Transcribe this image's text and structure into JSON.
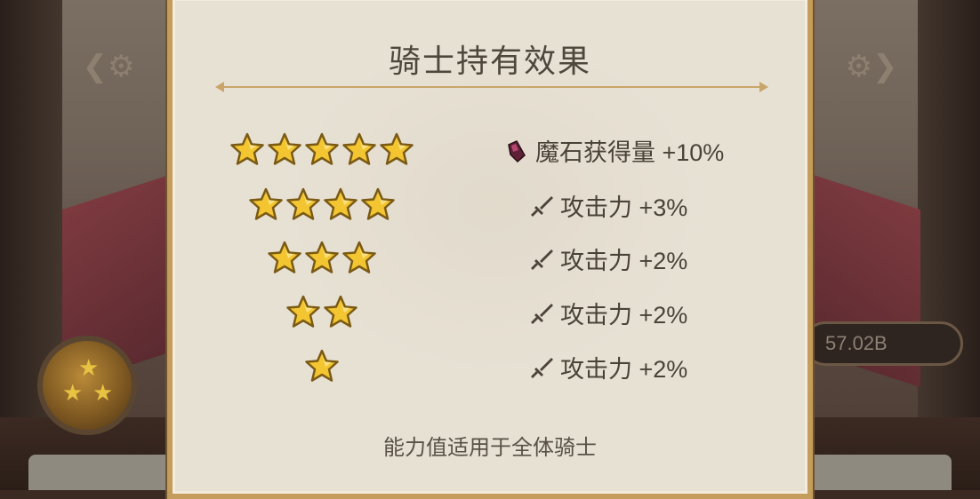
{
  "dialog": {
    "title": "骑士持有效果",
    "footer": "能力值适用于全体骑士",
    "tiers": [
      {
        "stars": 5,
        "effect_icon": "magic-stone-icon",
        "effect": "魔石获得量 +10%"
      },
      {
        "stars": 4,
        "effect_icon": "sword-icon",
        "effect": "攻击力 +3%"
      },
      {
        "stars": 3,
        "effect_icon": "sword-icon",
        "effect": "攻击力 +2%"
      },
      {
        "stars": 2,
        "effect_icon": "sword-icon",
        "effect": "攻击力 +2%"
      },
      {
        "stars": 1,
        "effect_icon": "sword-icon",
        "effect": "攻击力 +2%"
      }
    ]
  },
  "background": {
    "currency_value": "57.02B"
  },
  "colors": {
    "dialog_bg": "#e7e1d4",
    "dialog_border": "#c49c5c",
    "star_gold": "#f2c531",
    "text": "#4a4238"
  }
}
